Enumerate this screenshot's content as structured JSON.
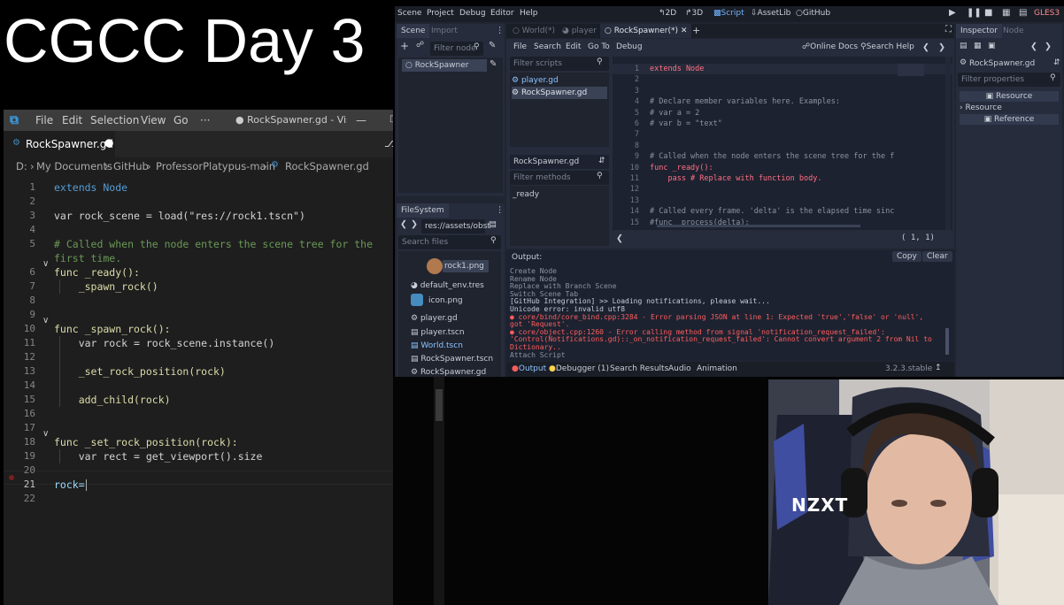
{
  "overlay_title": "CGCC Day 3",
  "vscode": {
    "menu": [
      "File",
      "Edit",
      "Selection",
      "View",
      "Go",
      "···"
    ],
    "window_title": "● RockSpawner.gd - Visu...",
    "tab_label": "RockSpawner.gd",
    "breadcrumb": [
      "D:",
      "My Documents",
      "GitHub",
      "ProfessorPlatypus-main",
      "RockSpawner.gd"
    ],
    "line_numbers": [
      "1",
      "2",
      "3",
      "4",
      "5",
      "",
      "6",
      "7",
      "8",
      "9",
      "10",
      "11",
      "12",
      "13",
      "14",
      "15",
      "16",
      "17",
      "18",
      "19",
      "20",
      "21",
      "22"
    ],
    "code": [
      "extends Node",
      "",
      "var rock_scene = load(\"res://rock1.tscn\")",
      "",
      "# Called when the node enters the scene tree for the",
      "first time.",
      "func _ready():",
      "    _spawn_rock()",
      "",
      "",
      "func _spawn_rock():",
      "    var rock = rock_scene.instance()",
      "",
      "    _set_rock_position(rock)",
      "",
      "    add_child(rock)",
      "",
      "",
      "func _set_rock_position(rock):",
      "    var rect = get_viewport().size",
      "",
      "rock=",
      ""
    ]
  },
  "godot": {
    "menu": [
      "Scene",
      "Project",
      "Debug",
      "Editor",
      "Help"
    ],
    "workspaces": [
      "2D",
      "3D",
      "Script",
      "AssetLib",
      "GitHub"
    ],
    "renderer": "GLES3",
    "scene_dock": {
      "tabs": [
        "Scene",
        "Import"
      ],
      "filter_placeholder": "Filter node",
      "root_node": "RockSpawner"
    },
    "filesystem": {
      "tab": "FileSystem",
      "path": "res://assets/obst",
      "search_placeholder": "Search files",
      "files": [
        "rock1.png",
        "default_env.tres",
        "icon.png",
        "player.gd",
        "player.tscn",
        "World.tscn",
        "RockSpawner.tscn",
        "RockSpawner.gd"
      ]
    },
    "scene_tabs": [
      "World(*)",
      "player",
      "RockSpawner(*)"
    ],
    "script_menu": [
      "File",
      "Search",
      "Edit",
      "Go To",
      "Debug"
    ],
    "script_links": [
      "Online Docs",
      "Search Help"
    ],
    "filter_scripts_placeholder": "Filter scripts",
    "scripts": [
      "player.gd",
      "RockSpawner.gd"
    ],
    "methods_header": "RockSpawner.gd",
    "filter_methods_placeholder": "Filter methods",
    "methods": [
      "_ready"
    ],
    "code_line_numbers": [
      "1",
      "2",
      "3",
      "4",
      "5",
      "6",
      "7",
      "8",
      "9",
      "10",
      "11",
      "12",
      "13",
      "14",
      "15"
    ],
    "code": [
      "extends Node",
      "",
      "",
      "# Declare member variables here. Examples:",
      "# var a = 2",
      "# var b = \"text\"",
      "",
      "",
      "# Called when the node enters the scene tree for the f",
      "func _ready():",
      "    pass # Replace with function body.",
      "",
      "",
      "# Called every frame. 'delta' is the elapsed time sinc",
      "#func _process(delta):"
    ],
    "cursor_pos": "( 1, 1)",
    "output": {
      "label": "Output:",
      "buttons": [
        "Copy",
        "Clear"
      ],
      "lines": [
        {
          "text": "Create Node",
          "error": false
        },
        {
          "text": "Rename Node",
          "error": false
        },
        {
          "text": "Replace with Branch Scene",
          "error": false
        },
        {
          "text": "Switch Scene Tab",
          "error": false
        },
        {
          "text": "[GitHub Integration] >> Loading notifications, please wait...",
          "error": false
        },
        {
          "text": "Unicode error: invalid utf8",
          "error": false
        },
        {
          "text": "● core/bind/core_bind.cpp:3284 - Error parsing JSON at line 1: Expected 'true','false' or 'null',",
          "error": true
        },
        {
          "text": "got 'Request'.",
          "error": true
        },
        {
          "text": "● core/object.cpp:1260 - Error calling method from signal 'notification_request_failed':",
          "error": true
        },
        {
          "text": "'Control(Notifications.gd)::_on_notification_request_failed': Cannot convert argument 2 from Nil to",
          "error": true
        },
        {
          "text": "Dictionary..",
          "error": true
        },
        {
          "text": "Attach Script",
          "error": false
        }
      ]
    },
    "bottom_tabs": [
      "Output",
      "Debugger (1)",
      "Search Results",
      "Audio",
      "Animation"
    ],
    "version": "3.2.3.stable",
    "inspector": {
      "tabs": [
        "Inspector",
        "Node"
      ],
      "object": "RockSpawner.gd",
      "filter_placeholder": "Filter properties",
      "rows": [
        "Resource",
        "Resource",
        "Reference"
      ]
    }
  },
  "webcam": {
    "chair_brand": "NZXT"
  }
}
